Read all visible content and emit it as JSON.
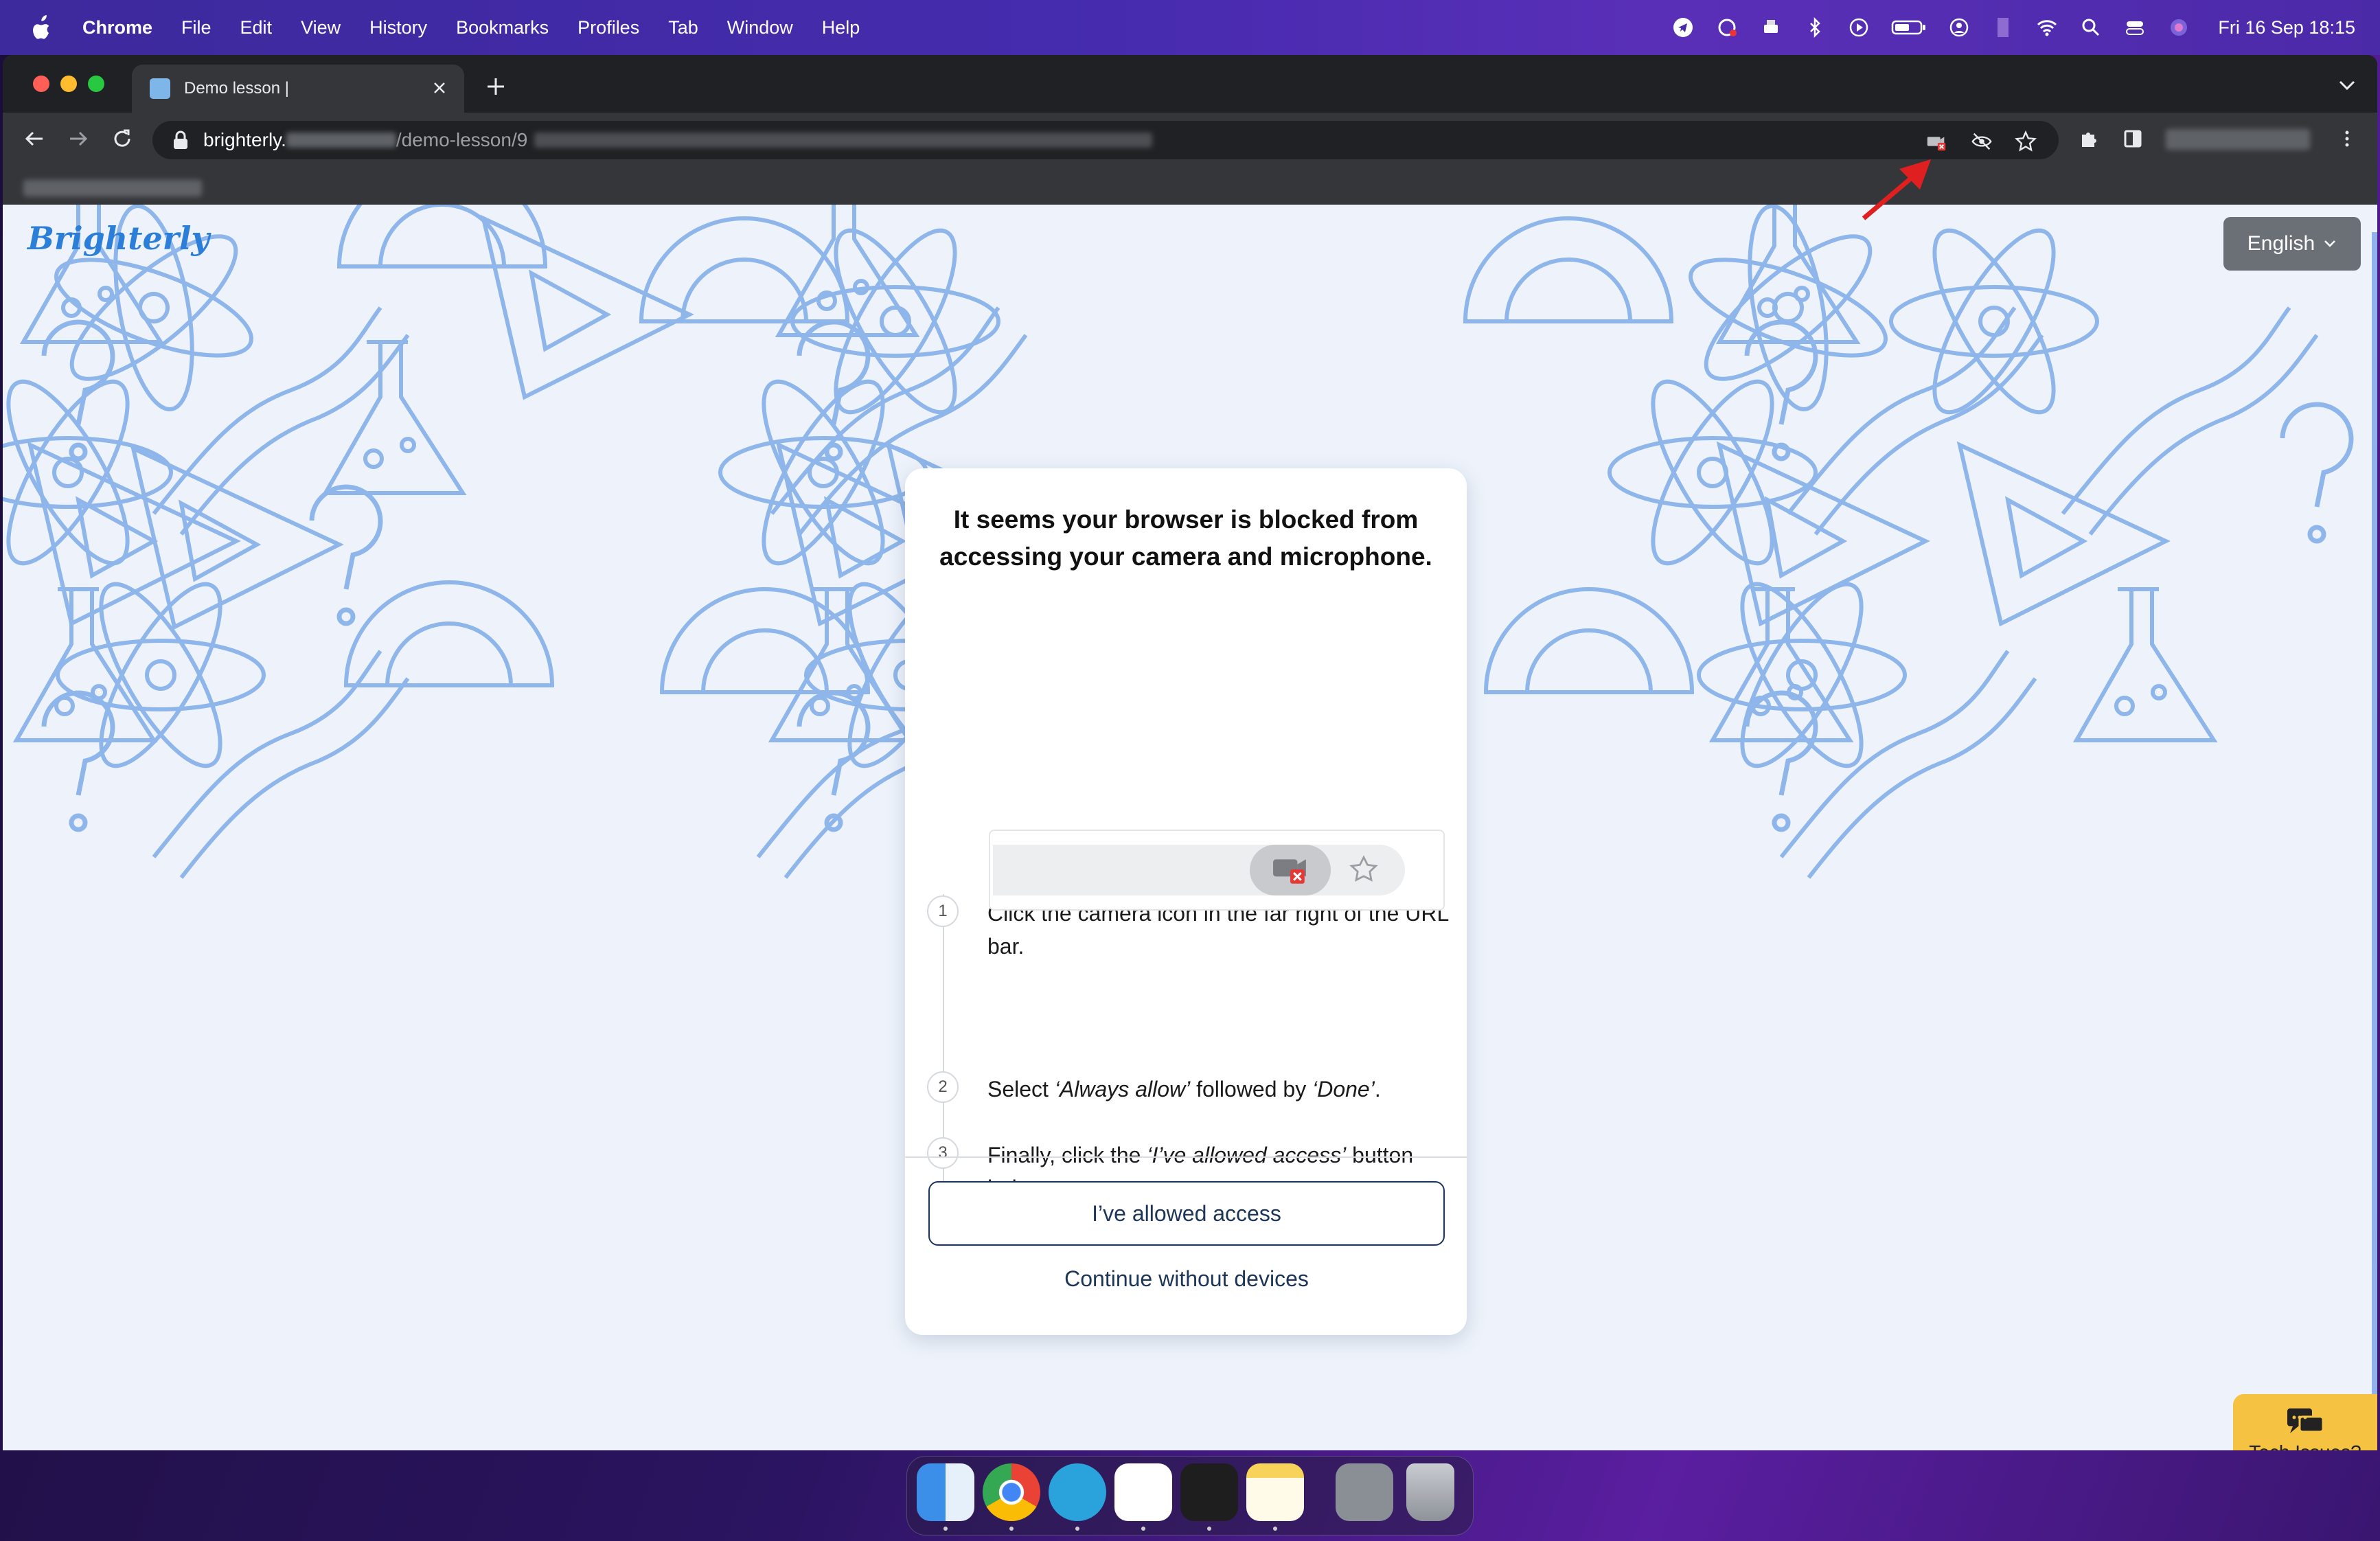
{
  "menubar": {
    "app_name": "Chrome",
    "menus": [
      "File",
      "Edit",
      "View",
      "History",
      "Bookmarks",
      "Profiles",
      "Tab",
      "Window",
      "Help"
    ],
    "clock": "Fri 16 Sep  18:15"
  },
  "browser": {
    "tab_title": "Demo lesson |",
    "url_host": "brighterly.",
    "url_path": "/demo-lesson/9"
  },
  "page": {
    "logo_text": "Brighterly",
    "language": "English"
  },
  "modal": {
    "title": "It seems your browser is blocked from accessing your camera and microphone.",
    "steps": [
      {
        "num": "1",
        "text": "Click the camera icon in the far right of the URL bar."
      },
      {
        "num": "2",
        "pre": "Select ",
        "em1": "‘Always allow’",
        "mid": " followed by ",
        "em2": "‘Done’",
        "post": "."
      },
      {
        "num": "3",
        "pre": "Finally, click the ",
        "em1": "‘I’ve allowed access’",
        "mid": " button below."
      }
    ],
    "primary_button": "I’ve allowed access",
    "secondary_button": "Continue without devices"
  },
  "tech_widget": {
    "label": "Tech Issues?"
  },
  "colors": {
    "accent": "#1d3557",
    "pattern": "#8fb6ea",
    "tech_bg": "#f5c242",
    "annotation_arrow": "#e02020"
  }
}
